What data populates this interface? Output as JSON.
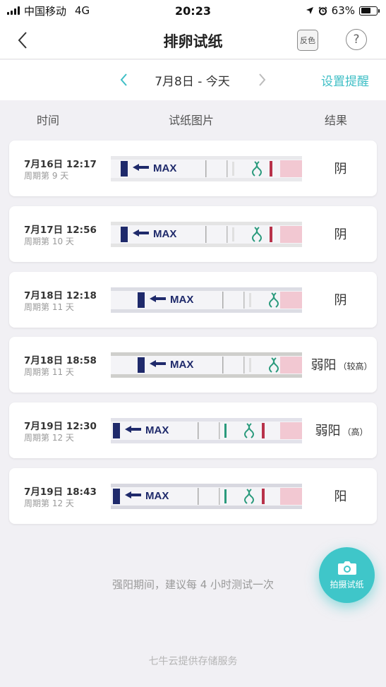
{
  "status_bar": {
    "carrier": "中国移动",
    "network": "4G",
    "time": "20:23",
    "battery": "63%",
    "battery_level": 0.63
  },
  "nav": {
    "title": "排卵试纸",
    "invert_label": "反色",
    "help_label": "?"
  },
  "date_bar": {
    "range": "7月8日 - 今天",
    "reminder_label": "设置提醒"
  },
  "columns": {
    "time": "时间",
    "image": "试纸图片",
    "result": "结果"
  },
  "strip_text": "MAX",
  "records": [
    {
      "datetime": "7月16日 12:17",
      "cycle": "周期第 9 天",
      "result": "阴",
      "level": ""
    },
    {
      "datetime": "7月17日 12:56",
      "cycle": "周期第 10 天",
      "result": "阴",
      "level": ""
    },
    {
      "datetime": "7月18日 12:18",
      "cycle": "周期第 11 天",
      "result": "阴",
      "level": ""
    },
    {
      "datetime": "7月18日 18:58",
      "cycle": "周期第 11 天",
      "result": "弱阳",
      "level": "（较高）"
    },
    {
      "datetime": "7月19日 12:30",
      "cycle": "周期第 12 天",
      "result": "弱阳",
      "level": "（高）"
    },
    {
      "datetime": "7月19日 18:43",
      "cycle": "周期第 12 天",
      "result": "阳",
      "level": ""
    }
  ],
  "advice": "强阳期间，建议每 4 小时测试一次",
  "camera_button_label": "拍摄试纸",
  "footer": "七牛云提供存储服务",
  "colors": {
    "accent": "#3fc6c9",
    "background": "#f1f0f4",
    "strip_blue": "#1f2a6b",
    "test_line": "#b8324a"
  }
}
